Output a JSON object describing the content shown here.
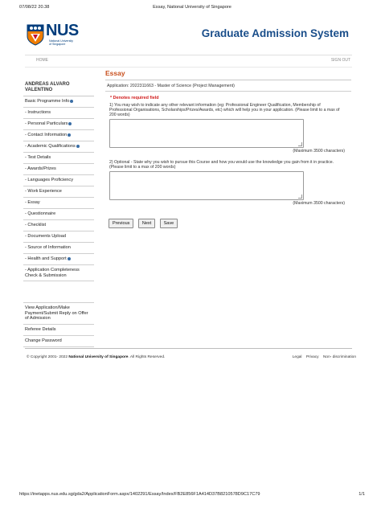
{
  "print": {
    "datetime": "07/08/22 20.38",
    "title": "Essay, National University of Singapore",
    "url": "https://inetapps.nus.edu.sg/gda2/ApplicationForm.aspx/1402291/Essay/Index/FB2E856F1A414D37B8210578D9C17C79",
    "page": "1/1"
  },
  "logo": {
    "word": "NUS",
    "sub_line1": "National University",
    "sub_line2": "of Singapore",
    "brand_color": "#003d7c"
  },
  "header": {
    "system_title": "Graduate Admission System"
  },
  "nav": {
    "home": "HOME",
    "sign_out": "SIGN OUT"
  },
  "sidebar": {
    "user": "ANDREAS ALVARO VALENTINO",
    "items": [
      {
        "label": "Basic Programme Info",
        "arrow": true
      },
      {
        "label": "- Instructions",
        "arrow": false
      },
      {
        "label": "- Personal Particulars",
        "arrow": true
      },
      {
        "label": "- Contact Information",
        "arrow": true
      },
      {
        "label": "- Academic Qualifications",
        "arrow": true
      },
      {
        "label": "- Test Details",
        "arrow": false
      },
      {
        "label": "- Awards/Prizes",
        "arrow": false
      },
      {
        "label": "- Languages Proficiency",
        "arrow": false
      },
      {
        "label": "- Work Experience",
        "arrow": false
      },
      {
        "label": "- Essay",
        "arrow": false
      },
      {
        "label": "- Questionnaire",
        "arrow": false
      },
      {
        "label": "- Checklist",
        "arrow": false
      },
      {
        "label": "- Documents Upload",
        "arrow": false
      },
      {
        "label": "- Source of Information",
        "arrow": false
      },
      {
        "label": "- Health and Support",
        "arrow": true
      },
      {
        "label": "- Application Completeness Check & Submission",
        "arrow": false
      }
    ],
    "bottom_items": [
      {
        "label": "View Application/Make Payment/Submit Reply on Offer of Admission"
      },
      {
        "label": "Referee Details"
      },
      {
        "label": "Change Password"
      }
    ]
  },
  "main": {
    "title": "Essay",
    "application_line": "Application: 2022311663 - Master of Science (Project Management)",
    "required_note": "* Denotes required field",
    "q1": "1) You may wish to indicate any other relevant information (eg: Professional Engineer Qualification, Membership of Professional Organisations, Scholarships/Prizes/Awards, etc) which will help you in your application. (Please limit to a max of 200 words)",
    "q1_value": "",
    "q1_max": "(Maximum 3500 characters)",
    "q2": "2) Optional - State why you wish to pursue this Course and how you would use the knowledge you gain from it in practice. (Please limit to a max of 200 words)",
    "q2_value": "",
    "q2_max": "(Maximum 3500 characters)",
    "buttons": {
      "previous": "Previous",
      "next": "Next",
      "save": "Save"
    },
    "accent_color": "#c8501e"
  },
  "footer": {
    "copyright_prefix": "© Copyright 2001- 2022",
    "copyright_org": "National University of Singapore",
    "copyright_suffix": ". All Rights Reserved.",
    "links": [
      "Legal",
      "Privacy",
      "Non- discrimination"
    ]
  }
}
